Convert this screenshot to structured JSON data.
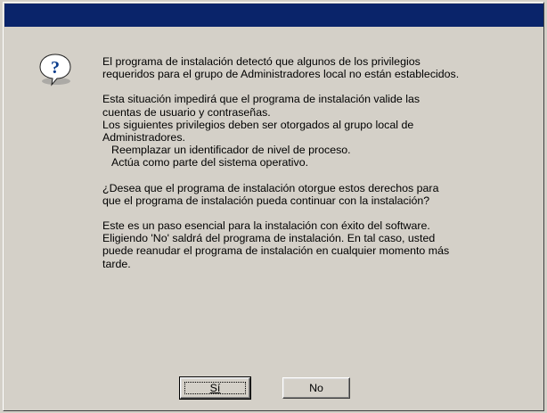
{
  "dialog": {
    "title": "",
    "icon": "question-icon",
    "paragraphs": [
      [
        "El programa de instalación detectó que algunos de los privilegios",
        "requeridos para el grupo de Administradores local no están establecidos."
      ],
      [
        "Esta situación impedirá que el programa de instalación valide las",
        "cuentas de usuario y contraseñas.",
        "Los siguientes privilegios deben ser otorgados al grupo local de",
        "Administradores."
      ],
      [
        "¿Desea que el programa de instalación otorgue estos derechos para",
        "que el programa de instalación pueda continuar con la instalación?"
      ],
      [
        "Este es un paso esencial para la instalación con éxito del software.",
        "Eligiendo 'No' saldrá del programa de instalación. En tal caso, usted",
        "puede reanudar el programa de instalación en cualquier momento más",
        "tarde."
      ]
    ],
    "privileges": [
      "Reemplazar un identificador de nivel de proceso.",
      "Actúa como parte del sistema operativo."
    ],
    "buttons": {
      "yes_label": "Sí",
      "no_label": "No"
    }
  },
  "colors": {
    "titlebar": "#0a246a",
    "face": "#d4d0c8",
    "icon_blue": "#0a3c8c"
  }
}
